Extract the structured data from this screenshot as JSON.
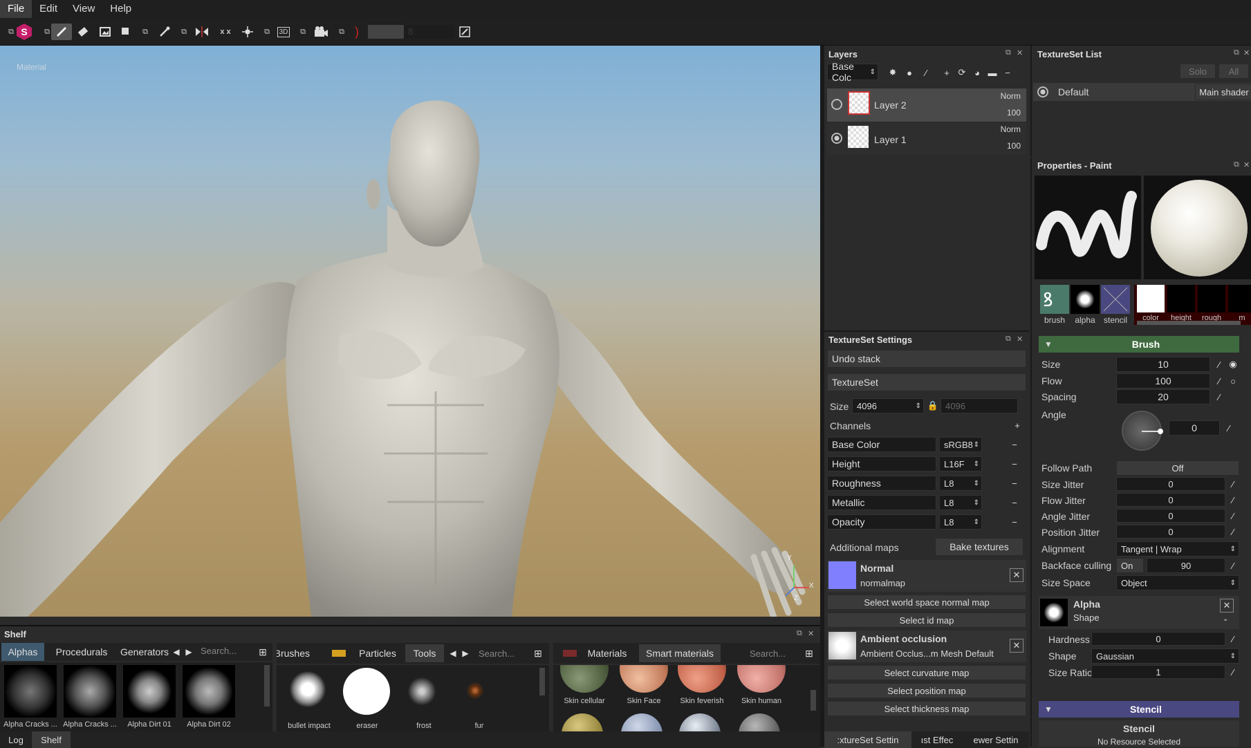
{
  "menu": {
    "items": [
      "File",
      "Edit",
      "View",
      "Help"
    ]
  },
  "toolbar": {
    "opacity_value": "8"
  },
  "viewport": {
    "channel_label": "Material",
    "axis_y": "Y",
    "axis_z": "Z",
    "axis_x": "X"
  },
  "layers": {
    "title": "Layers",
    "channel_select": "Base Colc",
    "items": [
      {
        "name": "Layer 2",
        "blend": "Norm",
        "opacity": "100"
      },
      {
        "name": "Layer 1",
        "blend": "Norm",
        "opacity": "100"
      }
    ]
  },
  "textureset_list": {
    "title": "TextureSet List",
    "solo": "Solo",
    "all": "All",
    "default_label": "Default",
    "shader_btn": "Main shader"
  },
  "textureset_settings": {
    "title": "TextureSet Settings",
    "undo_stack": "Undo stack",
    "textureset": "TextureSet",
    "size_label": "Size",
    "size_a": "4096",
    "size_b": "4096",
    "channels_label": "Channels",
    "channels": [
      {
        "name": "Base Color",
        "format": "sRGB8"
      },
      {
        "name": "Height",
        "format": "L16F"
      },
      {
        "name": "Roughness",
        "format": "L8"
      },
      {
        "name": "Metallic",
        "format": "L8"
      },
      {
        "name": "Opacity",
        "format": "L8"
      }
    ],
    "additional_maps": "Additional maps",
    "bake_btn": "Bake textures",
    "normal_title": "Normal",
    "normal_sub": "normalmap",
    "select_world_normal": "Select world space normal map",
    "select_id": "Select id map",
    "ao_title": "Ambient occlusion",
    "ao_sub": "Ambient Occlus...m Mesh Default",
    "select_curvature": "Select curvature map",
    "select_position": "Select position map",
    "select_thickness": "Select thickness map",
    "bottom_tabs": [
      ":xtureSet Settin",
      "ıst Effec",
      "ewer Settin"
    ]
  },
  "properties": {
    "title": "Properties - Paint",
    "slot_labels": [
      "brush",
      "alpha",
      "stencil"
    ],
    "material_labels": [
      "color",
      "height",
      "rough",
      "m"
    ],
    "brush_section": "Brush",
    "size_label": "Size",
    "size_value": "10",
    "flow_label": "Flow",
    "flow_value": "100",
    "spacing_label": "Spacing",
    "spacing_value": "20",
    "angle_label": "Angle",
    "angle_value": "0",
    "follow_path_label": "Follow Path",
    "follow_path_value": "Off",
    "size_jitter_label": "Size Jitter",
    "size_jitter_value": "0",
    "flow_jitter_label": "Flow Jitter",
    "flow_jitter_value": "0",
    "angle_jitter_label": "Angle Jitter",
    "angle_jitter_value": "0",
    "position_jitter_label": "Position Jitter",
    "position_jitter_value": "0",
    "alignment_label": "Alignment",
    "alignment_value": "Tangent | Wrap",
    "backface_label": "Backface culling",
    "backface_toggle": "On",
    "backface_value": "90",
    "size_space_label": "Size Space",
    "size_space_value": "Object",
    "alpha_title": "Alpha",
    "alpha_sub": "Shape",
    "hardness_label": "Hardness",
    "hardness_value": "0",
    "shape_label": "Shape",
    "shape_value": "Gaussian",
    "size_ratio_label": "Size Ratio",
    "size_ratio_value": "1",
    "stencil_section": "Stencil",
    "stencil_sub": "Stencil",
    "no_resource": "No Resource Selected"
  },
  "shelf": {
    "title": "Shelf",
    "tabs_left": [
      "Alphas",
      "Procedurals",
      "Generators"
    ],
    "search_placeholder": "Search...",
    "alphas": [
      "Alpha Cracks ...",
      "Alpha Cracks ...",
      "Alpha Dirt 01",
      "Alpha Dirt 02"
    ],
    "tabs_mid": [
      "Brushes",
      "Particles",
      "Tools"
    ],
    "tools": [
      "bullet impact",
      "eraser",
      "frost",
      "fur"
    ],
    "tabs_right": [
      "Materials",
      "Smart materials"
    ],
    "materials": [
      "Skin cellular",
      "Skin Face",
      "Skin feverish",
      "Skin human"
    ]
  },
  "bottom_tabs": [
    "Log",
    "Shelf"
  ]
}
